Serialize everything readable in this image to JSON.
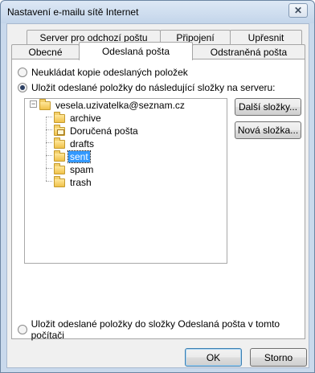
{
  "window": {
    "title": "Nastavení e-mailu sítě Internet",
    "close_glyph": "✕"
  },
  "tabs": {
    "row1": [
      {
        "label": "Server pro odchozí poštu"
      },
      {
        "label": "Připojení"
      },
      {
        "label": "Upřesnit"
      }
    ],
    "row2": [
      {
        "label": "Obecné"
      },
      {
        "label": "Odeslaná pošta"
      },
      {
        "label": "Odstraněná pošta"
      }
    ],
    "active": "Odeslaná pošta"
  },
  "sent_mail": {
    "option_no_copy": "Neukládat kopie odeslaných položek",
    "option_server_folder": "Uložit odeslané položky do následující složky na serveru:",
    "option_local_folder": "Uložit odeslané položky do složky Odeslaná pošta v tomto počítači",
    "selected_option": "server_folder"
  },
  "folder_tree": {
    "root": "vesela.uzivatelka@seznam.cz",
    "folders": [
      {
        "name": "archive",
        "icon": "folder-icon"
      },
      {
        "name": "Doručená pošta",
        "icon": "inbox-folder-icon"
      },
      {
        "name": "drafts",
        "icon": "folder-icon"
      },
      {
        "name": "sent",
        "icon": "folder-icon",
        "selected": true
      },
      {
        "name": "spam",
        "icon": "folder-icon"
      },
      {
        "name": "trash",
        "icon": "folder-icon"
      }
    ],
    "expander_glyph": "−"
  },
  "side_buttons": {
    "more_folders": "Další složky...",
    "new_folder": "Nová složka..."
  },
  "footer": {
    "ok": "OK",
    "cancel": "Storno"
  }
}
